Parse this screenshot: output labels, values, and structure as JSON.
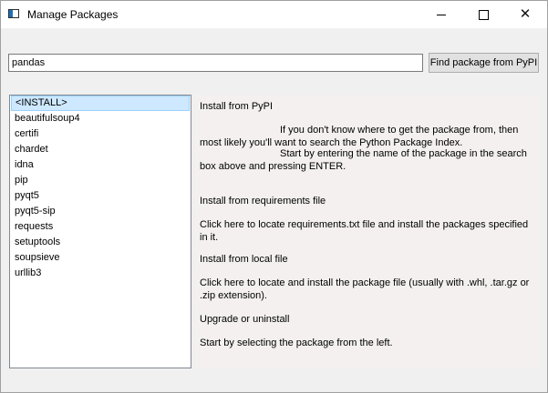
{
  "window": {
    "title": "Manage Packages",
    "controls": {
      "minimize": "—",
      "maximize": "☐",
      "close": "✕"
    }
  },
  "search": {
    "value": "pandas",
    "button_label": "Find package from PyPI"
  },
  "packages": [
    "<INSTALL>",
    "beautifulsoup4",
    "certifi",
    "chardet",
    "idna",
    "pip",
    "pyqt5",
    "pyqt5-sip",
    "requests",
    "setuptools",
    "soupsieve",
    "urllib3"
  ],
  "selected_package": "<INSTALL>",
  "info": {
    "pypi_title": "Install from PyPI",
    "pypi_text_1": "If you don't know where to get the package from, then most likely you'll want to search the Python Package Index.",
    "pypi_text_2": "Start by entering the name of the package in the search box above and pressing ENTER.",
    "req_title": "Install from requirements file",
    "req_text": "Click here to locate requirements.txt file and install the packages specified in it.",
    "local_title": "Install from local file",
    "local_text": "Click here to locate and install the package file (usually with .whl, .tar.gz or .zip extension).",
    "upgrade_title": "Upgrade or uninstall",
    "upgrade_text": "Start by selecting the package from the left."
  }
}
